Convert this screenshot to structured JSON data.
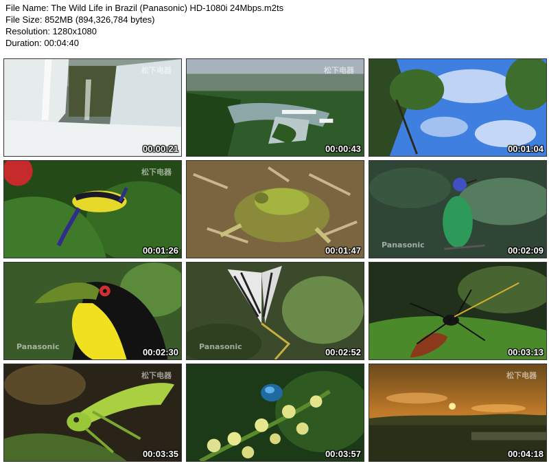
{
  "info": {
    "file_name": "File Name: The Wild Life in Brazil (Panasonic) HD-1080i 24Mbps.m2ts",
    "file_size": "File Size: 852MB (894,326,784 bytes)",
    "resolution": "Resolution: 1280x1080",
    "duration": "Duration: 00:04:40"
  },
  "thumbnails": [
    {
      "time": "00:00:21",
      "watermark": "松下电器"
    },
    {
      "time": "00:00:43",
      "watermark": "松下电器"
    },
    {
      "time": "00:01:04",
      "watermark": ""
    },
    {
      "time": "00:01:26",
      "watermark": "松下电器"
    },
    {
      "time": "00:01:47",
      "watermark": ""
    },
    {
      "time": "00:02:09",
      "watermark": "Panasonic"
    },
    {
      "time": "00:02:30",
      "watermark": "Panasonic"
    },
    {
      "time": "00:02:52",
      "watermark": "Panasonic"
    },
    {
      "time": "00:03:13",
      "watermark": ""
    },
    {
      "time": "00:03:35",
      "watermark": "松下电器"
    },
    {
      "time": "00:03:57",
      "watermark": ""
    },
    {
      "time": "00:04:18",
      "watermark": "松下电器"
    }
  ]
}
